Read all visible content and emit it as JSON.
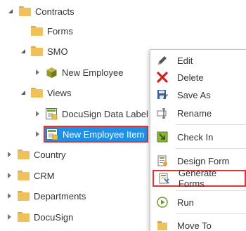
{
  "tree": {
    "items": [
      {
        "label": "Contracts"
      },
      {
        "label": "Forms"
      },
      {
        "label": "SMO"
      },
      {
        "label": "New Employee"
      },
      {
        "label": "Views"
      },
      {
        "label": "DocuSign Data Label"
      },
      {
        "label": "New Employee Item"
      },
      {
        "label": "Country"
      },
      {
        "label": "CRM"
      },
      {
        "label": "Departments"
      },
      {
        "label": "DocuSign"
      }
    ]
  },
  "context_menu": {
    "items": [
      {
        "label": "Edit",
        "icon": "pencil-icon"
      },
      {
        "label": "Delete",
        "icon": "red-x-icon"
      },
      {
        "label": "Save As",
        "icon": "save-as-icon"
      },
      {
        "label": "Rename",
        "icon": "rename-icon"
      },
      {
        "label": "Check In",
        "icon": "check-in-icon"
      },
      {
        "label": "Design Form",
        "icon": "design-form-icon"
      },
      {
        "label": "Generate Forms",
        "icon": "generate-forms-icon"
      },
      {
        "label": "Run",
        "icon": "run-icon"
      },
      {
        "label": "Move To",
        "icon": "move-to-icon"
      }
    ]
  },
  "colors": {
    "selection": "#1e90e8",
    "highlight_border": "#e03434",
    "folder": "#f0c05a"
  }
}
